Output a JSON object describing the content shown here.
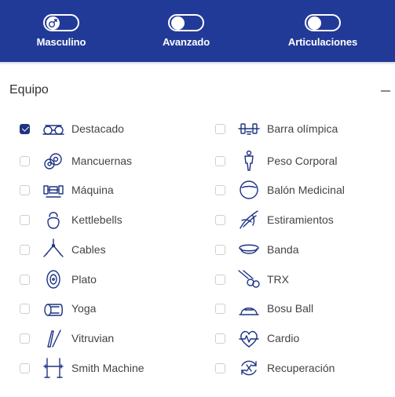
{
  "header": {
    "toggles": [
      {
        "label": "Masculino",
        "icon": "male-symbol-icon"
      },
      {
        "label": "Avanzado",
        "icon": ""
      },
      {
        "label": "Articulaciones",
        "icon": ""
      }
    ]
  },
  "equipment": {
    "title": "Equipo",
    "left": [
      {
        "label": "Destacado",
        "checked": true,
        "icon": "featured-equipment-icon"
      },
      {
        "label": "Mancuernas",
        "checked": false,
        "icon": "dumbbell-plates-icon"
      },
      {
        "label": "Máquina",
        "checked": false,
        "icon": "machine-icon"
      },
      {
        "label": "Kettlebells",
        "checked": false,
        "icon": "kettlebell-icon"
      },
      {
        "label": "Cables",
        "checked": false,
        "icon": "cables-icon"
      },
      {
        "label": "Plato",
        "checked": false,
        "icon": "plate-icon"
      },
      {
        "label": "Yoga",
        "checked": false,
        "icon": "yoga-mat-icon"
      },
      {
        "label": "Vitruvian",
        "checked": false,
        "icon": "vitruvian-icon"
      },
      {
        "label": "Smith Machine",
        "checked": false,
        "icon": "smith-machine-icon"
      }
    ],
    "right": [
      {
        "label": "Barra olímpica",
        "checked": false,
        "icon": "olympic-bar-icon"
      },
      {
        "label": "Peso Corporal",
        "checked": false,
        "icon": "bodyweight-icon"
      },
      {
        "label": "Balón Medicinal",
        "checked": false,
        "icon": "medicine-ball-icon"
      },
      {
        "label": "Estiramientos",
        "checked": false,
        "icon": "stretching-icon"
      },
      {
        "label": "Banda",
        "checked": false,
        "icon": "band-icon"
      },
      {
        "label": "TRX",
        "checked": false,
        "icon": "trx-icon"
      },
      {
        "label": "Bosu Ball",
        "checked": false,
        "icon": "bosu-ball-icon"
      },
      {
        "label": "Cardio",
        "checked": false,
        "icon": "cardio-icon"
      },
      {
        "label": "Recuperación",
        "checked": false,
        "icon": "recovery-icon"
      }
    ]
  },
  "colors": {
    "header_bg": "#223a97",
    "accent": "#1e3384",
    "icon": "#1e3384"
  }
}
